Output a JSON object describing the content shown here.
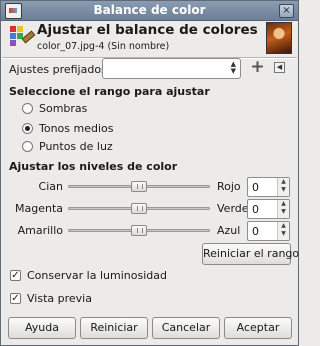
{
  "window": {
    "title": "Balance de color"
  },
  "header": {
    "title": "Ajustar el balance de colores",
    "subtitle": "color_07.jpg-4 (Sin nombre)"
  },
  "presets": {
    "label": "Ajustes prefijados:",
    "value": ""
  },
  "range": {
    "title": "Seleccione el rango para ajustar",
    "options": [
      {
        "label": "Sombras",
        "selected": false
      },
      {
        "label": "Tonos medios",
        "selected": true
      },
      {
        "label": "Puntos de luz",
        "selected": false
      }
    ]
  },
  "levels": {
    "title": "Ajustar los niveles de color",
    "sliders": [
      {
        "left": "Cian",
        "right": "Rojo",
        "value": "0"
      },
      {
        "left": "Magenta",
        "right": "Verde",
        "value": "0"
      },
      {
        "left": "Amarillo",
        "right": "Azul",
        "value": "0"
      }
    ],
    "reset_range_label": "Reiniciar el rango"
  },
  "checks": {
    "preserve_luminosity": {
      "label": "Conservar la luminosidad",
      "checked": true
    },
    "preview": {
      "label": "Vista previa",
      "checked": true
    }
  },
  "buttons": {
    "help": "Ayuda",
    "reset": "Reiniciar",
    "cancel": "Cancelar",
    "ok": "Aceptar"
  },
  "icons": {
    "title_icon": "gimp-icon",
    "header_icon": "color-balance-icon",
    "add": "plus-icon",
    "menu": "menu-arrow-icon"
  }
}
